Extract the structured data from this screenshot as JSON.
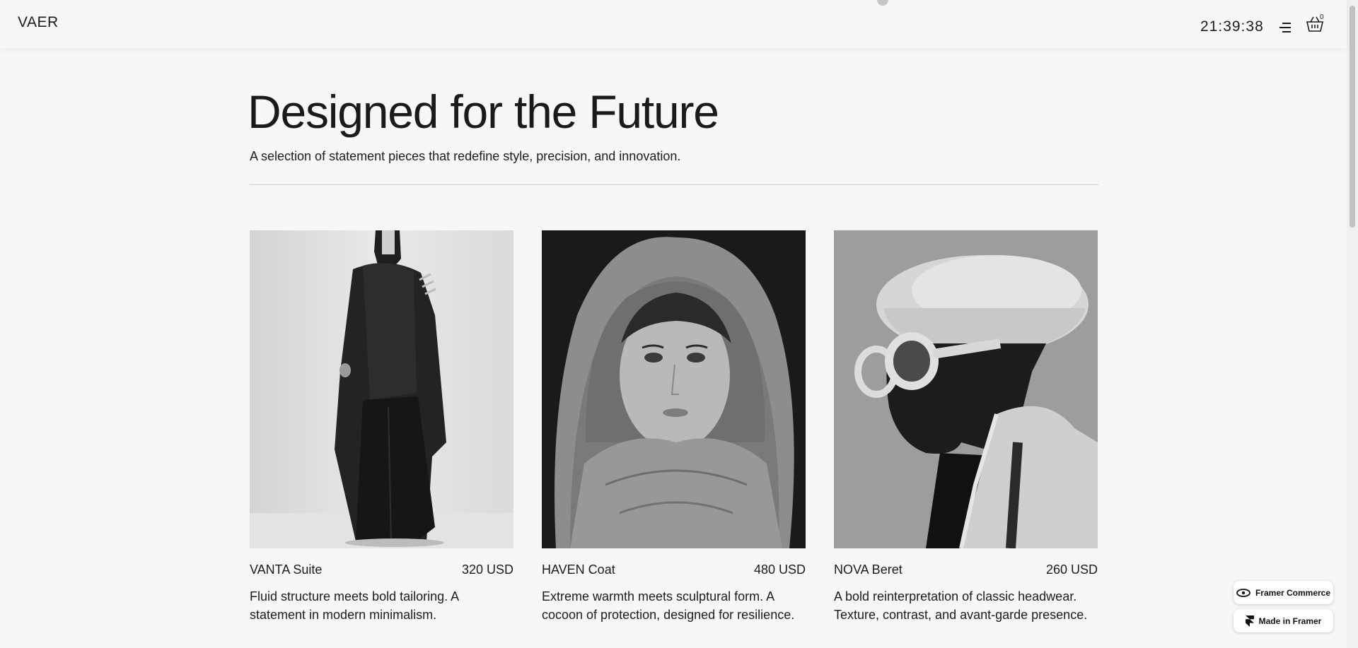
{
  "header": {
    "logo": "VAER",
    "clock": "21:39:38",
    "menu_icon": "menu-icon",
    "cart_icon": "basket-icon",
    "cart_count": "0"
  },
  "hero": {
    "title": "Designed for the Future",
    "subtitle": "A selection of statement pieces that redefine style, precision, and innovation."
  },
  "products": [
    {
      "name": "VANTA Suite",
      "price": "320 USD",
      "description": "Fluid structure meets bold tailoring. A statement in modern minimalism."
    },
    {
      "name": "HAVEN Coat",
      "price": "480 USD",
      "description": "Extreme warmth meets sculptural form. A cocoon of protection, designed for resilience."
    },
    {
      "name": "NOVA Beret",
      "price": "260 USD",
      "description": "A bold reinterpretation of classic headwear. Texture, contrast, and avant-garde presence."
    }
  ],
  "badges": {
    "commerce": "Framer Commerce",
    "made_in": "Made in Framer"
  },
  "colors": {
    "background": "#f7f7f7",
    "text": "#1c1c1c",
    "rule": "#cfcfcf"
  }
}
